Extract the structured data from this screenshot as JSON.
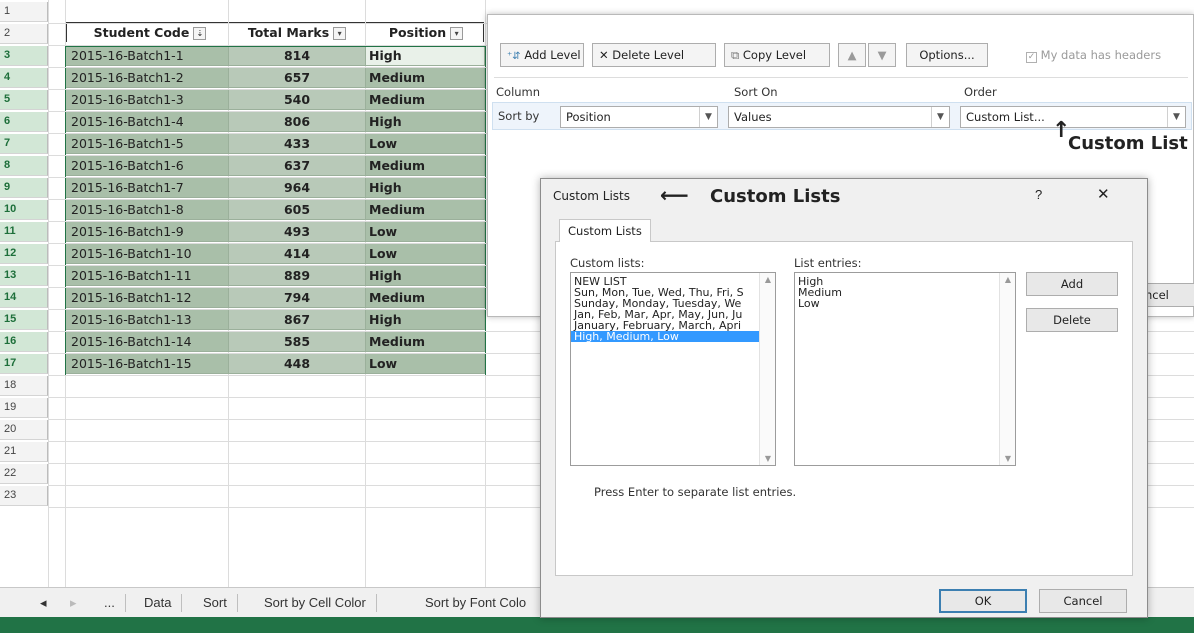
{
  "sheet": {
    "rows": [
      "1",
      "2",
      "3",
      "4",
      "5",
      "6",
      "7",
      "8",
      "9",
      "10",
      "11",
      "12",
      "13",
      "14",
      "15",
      "16",
      "17",
      "18",
      "19",
      "20",
      "21",
      "22",
      "23"
    ],
    "headers": {
      "code": "Student Code",
      "marks": "Total Marks",
      "position": "Position"
    },
    "data": [
      {
        "code": "2015-16-Batch1-1",
        "marks": "814",
        "position": "High"
      },
      {
        "code": "2015-16-Batch1-2",
        "marks": "657",
        "position": "Medium"
      },
      {
        "code": "2015-16-Batch1-3",
        "marks": "540",
        "position": "Medium"
      },
      {
        "code": "2015-16-Batch1-4",
        "marks": "806",
        "position": "High"
      },
      {
        "code": "2015-16-Batch1-5",
        "marks": "433",
        "position": "Low"
      },
      {
        "code": "2015-16-Batch1-6",
        "marks": "637",
        "position": "Medium"
      },
      {
        "code": "2015-16-Batch1-7",
        "marks": "964",
        "position": "High"
      },
      {
        "code": "2015-16-Batch1-8",
        "marks": "605",
        "position": "Medium"
      },
      {
        "code": "2015-16-Batch1-9",
        "marks": "493",
        "position": "Low"
      },
      {
        "code": "2015-16-Batch1-10",
        "marks": "414",
        "position": "Low"
      },
      {
        "code": "2015-16-Batch1-11",
        "marks": "889",
        "position": "High"
      },
      {
        "code": "2015-16-Batch1-12",
        "marks": "794",
        "position": "Medium"
      },
      {
        "code": "2015-16-Batch1-13",
        "marks": "867",
        "position": "High"
      },
      {
        "code": "2015-16-Batch1-14",
        "marks": "585",
        "position": "Medium"
      },
      {
        "code": "2015-16-Batch1-15",
        "marks": "448",
        "position": "Low"
      }
    ],
    "tabs": {
      "prev": "◂",
      "next": "▸",
      "more": "...",
      "t1": "Data",
      "t2": "Sort",
      "t3": "Sort by Cell Color",
      "t4": "Sort by Font Colo"
    },
    "colors": {
      "selected_fill": "#a9bfa9",
      "selected_alt": "#b8c9b8",
      "accent": "#217346"
    }
  },
  "sort_dialog": {
    "add_level": "Add Level",
    "delete_level": "Delete Level",
    "copy_level": "Copy Level",
    "up": "▲",
    "down": "▼",
    "options": "Options...",
    "headers_label": "My data has headers",
    "col_column": "Column",
    "col_sort_on": "Sort On",
    "col_order": "Order",
    "sort_by_label": "Sort by",
    "sort_by_value": "Position",
    "sort_on_value": "Values",
    "order_value": "Custom List...",
    "cancel_partial": "ncel"
  },
  "annotations": {
    "custom_list": "Custom List",
    "custom_lists": "Custom Lists",
    "arrow_up": "↑",
    "arrow_left": "⟵"
  },
  "custom_lists_dialog": {
    "title": "Custom Lists",
    "help": "?",
    "close": "✕",
    "tab": "Custom Lists",
    "lists_label": "Custom lists:",
    "entries_label": "List entries:",
    "lists": [
      "NEW LIST",
      "Sun, Mon, Tue, Wed, Thu, Fri, S",
      "Sunday, Monday, Tuesday, We",
      "Jan, Feb, Mar, Apr, May, Jun, Ju",
      "January, February, March, Apri",
      "High, Medium, Low"
    ],
    "entries": [
      "High",
      "Medium",
      "Low"
    ],
    "add": "Add",
    "delete": "Delete",
    "hint": "Press Enter to separate list entries.",
    "ok": "OK",
    "cancel": "Cancel"
  }
}
